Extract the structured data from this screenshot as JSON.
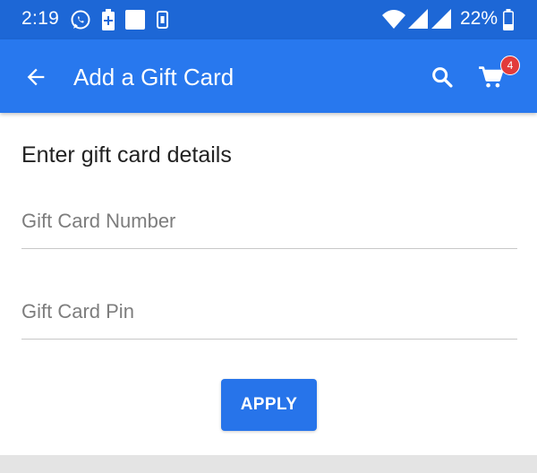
{
  "status_bar": {
    "time": "2:19",
    "battery_percent": "22%",
    "icons": [
      "whatsapp-icon",
      "battery-saver-icon",
      "square-notification-icon",
      "phone-battery-icon",
      "wifi-icon",
      "signal-icon",
      "signal-icon-2",
      "battery-icon"
    ]
  },
  "app_bar": {
    "title": "Add a Gift Card",
    "cart_count": "4",
    "icons": [
      "back-arrow-icon",
      "search-icon",
      "cart-icon"
    ]
  },
  "form": {
    "section_title": "Enter gift card details",
    "card_number": {
      "placeholder": "Gift Card Number",
      "value": ""
    },
    "card_pin": {
      "placeholder": "Gift Card Pin",
      "value": ""
    },
    "apply_label": "APPLY"
  },
  "colors": {
    "status_bar": "#1d67d6",
    "app_bar": "#2878ee",
    "button": "#2774ea",
    "badge": "#e23b3b"
  }
}
